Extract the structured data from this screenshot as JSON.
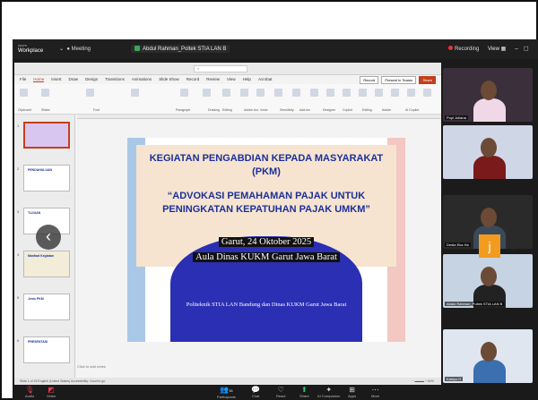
{
  "topbar": {
    "app_name": "zoom",
    "app_subtitle": "Workplace",
    "meeting_label": "Meeting",
    "share_title": "Abdul Rahman_Poltek STIA LAN B",
    "recording_label": "Recording",
    "view_label": "View"
  },
  "powerpoint": {
    "menu": [
      "File",
      "Home",
      "Insert",
      "Draw",
      "Design",
      "Transitions",
      "Animations",
      "Slide Show",
      "Record",
      "Review",
      "View",
      "Help",
      "Acrobat"
    ],
    "record_btn": "Record",
    "present_btn": "Present in Teams",
    "share_btn": "Share",
    "ribbon_groups": [
      "Clipboard",
      "Slides",
      "Font",
      "Paragraph",
      "Drawing",
      "Editing",
      "Adobe Acr.",
      "Voice",
      "Sensitivity",
      "Add-ins",
      "Designer",
      "Copilot",
      "Editing",
      "Adobe",
      "AI Copilot"
    ],
    "notes_placeholder": "Click to add notes",
    "status_text": "Slide 1 of 15   English (United States)   Accessibility: Good to go",
    "zoom_value": "60%",
    "thumb_numbers": [
      "1",
      "2",
      "3",
      "4",
      "5",
      "6"
    ],
    "thumb_titles": [
      "",
      "PENDAHULUAN",
      "TUJUAN",
      "Manfaat Kegiatan",
      "Jenis PKM",
      "PRESENTASI"
    ]
  },
  "slide": {
    "title_line1": "KEGIATAN PENGABDIAN KEPADA MASYARAKAT",
    "title_line2": "(PKM)",
    "subtitle_line1": "“ADVOKASI PEMAHAMAN PAJAK UNTUK",
    "subtitle_line2": "PENINGKATAN KEPATUHAN PAJAK UMKM”",
    "date": "Garut, 24 Oktober 2025",
    "place": "Aula Dinas KUKM Garut Jawa Barat",
    "footer": "Politeknik STIA LAN Bandung dan Dinas KUKM Garut Jawa Barat"
  },
  "participants": {
    "tiles": [
      {
        "name": "Pupi Juliana"
      },
      {
        "name": ""
      },
      {
        "name": "Dedia Eka Ha"
      },
      {
        "name": "Abdul Rahman_Poltek STIA LAN B"
      },
      {
        "name": "Kahiyo D"
      },
      {
        "name": ""
      }
    ],
    "initial_tile": "j"
  },
  "toolbar": {
    "audio": "Audio",
    "video": "Video",
    "participants": "Participants",
    "chat": "Chat",
    "react": "React",
    "share": "Share",
    "ai_companion": "AI Companion",
    "apps": "Apps",
    "more": "More",
    "participants_count": "36"
  },
  "colors": {
    "slide_title": "#1b2f9a",
    "slide_blob": "#2b2fb3",
    "accent_red": "#e5384a",
    "share_green": "#2ecc71"
  }
}
